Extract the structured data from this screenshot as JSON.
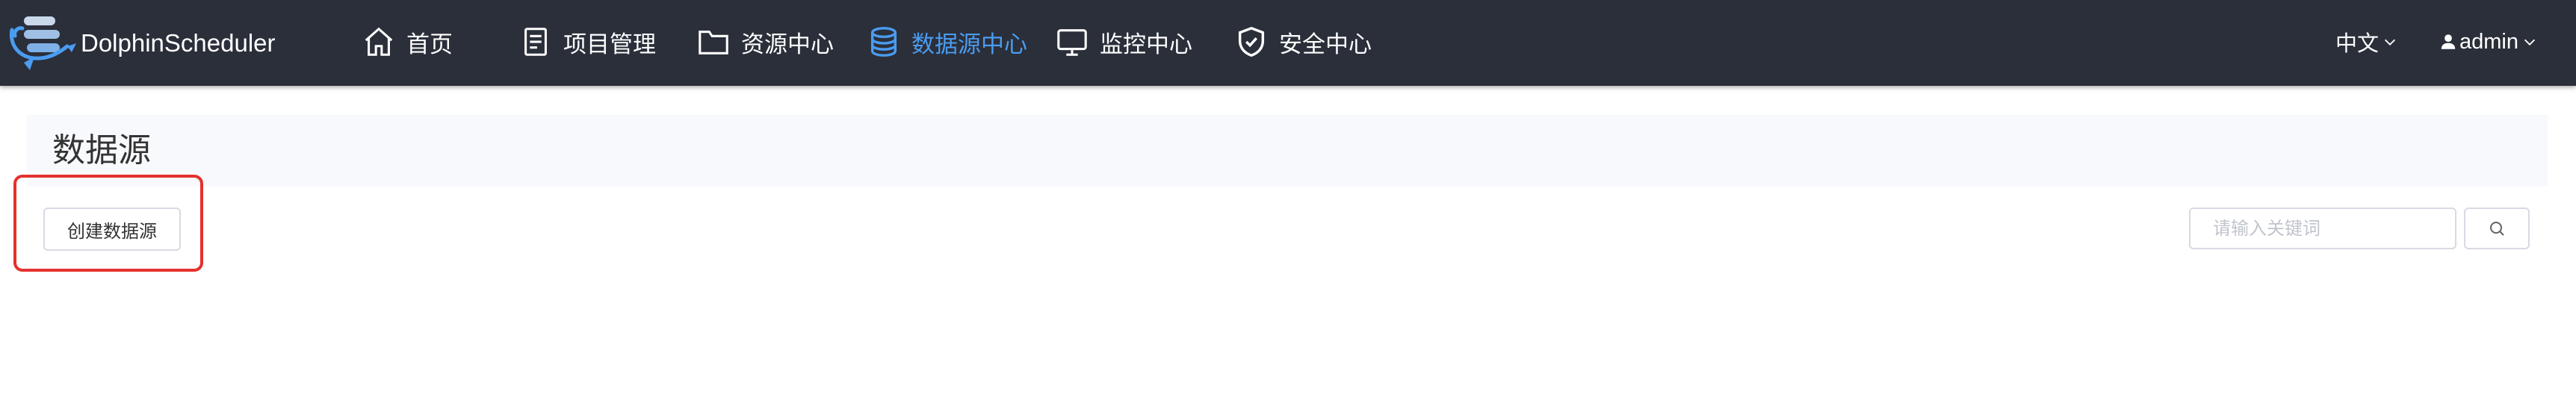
{
  "app": {
    "brand": "DolphinScheduler"
  },
  "nav": [
    {
      "id": "home",
      "label": "首页",
      "icon": "home-icon",
      "active": false
    },
    {
      "id": "projects",
      "label": "项目管理",
      "icon": "document-icon",
      "active": false
    },
    {
      "id": "resources",
      "label": "资源中心",
      "icon": "folder-icon",
      "active": false
    },
    {
      "id": "datasource",
      "label": "数据源中心",
      "icon": "database-icon",
      "active": true
    },
    {
      "id": "monitor",
      "label": "监控中心",
      "icon": "monitor-icon",
      "active": false
    },
    {
      "id": "security",
      "label": "安全中心",
      "icon": "shield-check-icon",
      "active": false
    }
  ],
  "header_right": {
    "language": "中文",
    "user": "admin"
  },
  "page": {
    "title": "数据源"
  },
  "toolbar": {
    "create_label": "创建数据源",
    "search_placeholder": "请输入关键词"
  },
  "colors": {
    "topbar": "#2b2f3a",
    "active": "#4a9cf0",
    "highlight": "#e5312e"
  }
}
